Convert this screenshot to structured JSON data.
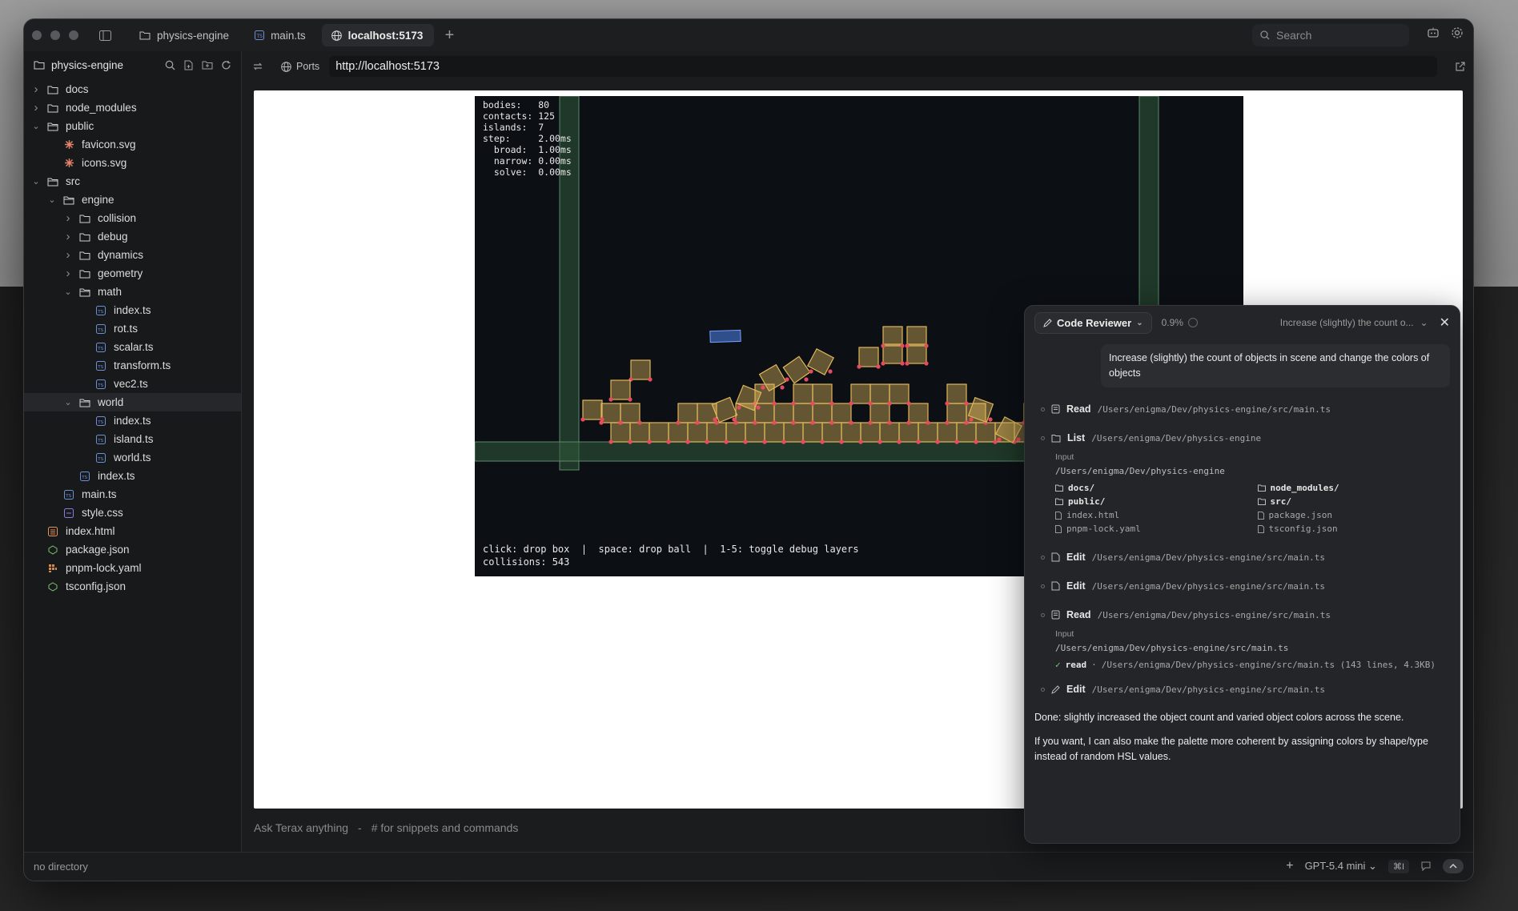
{
  "titlebar": {
    "tabs": [
      {
        "label": "physics-engine",
        "icon": "folder-icon"
      },
      {
        "label": "main.ts",
        "icon": "typescript-file-icon"
      },
      {
        "label": "localhost:5173",
        "icon": "globe-icon"
      }
    ],
    "search_placeholder": "Search"
  },
  "sidebar": {
    "project": "physics-engine",
    "tree": [
      {
        "label": "docs",
        "depth": 0,
        "type": "folder",
        "open": false
      },
      {
        "label": "node_modules",
        "depth": 0,
        "type": "folder",
        "open": false
      },
      {
        "label": "public",
        "depth": 0,
        "type": "folder",
        "open": true
      },
      {
        "label": "favicon.svg",
        "depth": 1,
        "type": "svg"
      },
      {
        "label": "icons.svg",
        "depth": 1,
        "type": "svg"
      },
      {
        "label": "src",
        "depth": 0,
        "type": "folder",
        "open": true
      },
      {
        "label": "engine",
        "depth": 1,
        "type": "folder",
        "open": true
      },
      {
        "label": "collision",
        "depth": 2,
        "type": "folder",
        "open": false
      },
      {
        "label": "debug",
        "depth": 2,
        "type": "folder",
        "open": false
      },
      {
        "label": "dynamics",
        "depth": 2,
        "type": "folder",
        "open": false
      },
      {
        "label": "geometry",
        "depth": 2,
        "type": "folder",
        "open": false
      },
      {
        "label": "math",
        "depth": 2,
        "type": "folder",
        "open": true
      },
      {
        "label": "index.ts",
        "depth": 3,
        "type": "ts"
      },
      {
        "label": "rot.ts",
        "depth": 3,
        "type": "ts"
      },
      {
        "label": "scalar.ts",
        "depth": 3,
        "type": "ts"
      },
      {
        "label": "transform.ts",
        "depth": 3,
        "type": "ts"
      },
      {
        "label": "vec2.ts",
        "depth": 3,
        "type": "ts"
      },
      {
        "label": "world",
        "depth": 2,
        "type": "folder",
        "open": true
      },
      {
        "label": "index.ts",
        "depth": 3,
        "type": "ts"
      },
      {
        "label": "island.ts",
        "depth": 3,
        "type": "ts"
      },
      {
        "label": "world.ts",
        "depth": 3,
        "type": "ts"
      },
      {
        "label": "index.ts",
        "depth": 2,
        "type": "ts"
      },
      {
        "label": "main.ts",
        "depth": 1,
        "type": "ts"
      },
      {
        "label": "style.css",
        "depth": 1,
        "type": "css"
      },
      {
        "label": "index.html",
        "depth": 0,
        "type": "html"
      },
      {
        "label": "package.json",
        "depth": 0,
        "type": "json"
      },
      {
        "label": "pnpm-lock.yaml",
        "depth": 0,
        "type": "yaml"
      },
      {
        "label": "tsconfig.json",
        "depth": 0,
        "type": "json"
      }
    ]
  },
  "browser": {
    "ports_label": "Ports",
    "url": "http://localhost:5173"
  },
  "sim": {
    "hud": "bodies:   80\ncontacts: 125\nislands:  7\nstep:     2.00ms\n  broad:  1.00ms\n  narrow: 0.00ms\n  solve:  0.00ms",
    "footer": "click: drop box  |  space: drop ball  |  1-5: toggle debug layers\ncollisions: 543"
  },
  "ask_bar": {
    "placeholder": "Ask Terax anything",
    "separator": "-",
    "hint": "# for snippets and commands"
  },
  "agent_panel": {
    "agent_name": "Code Reviewer",
    "context_pct": "0.9%",
    "title": "Increase (slightly) the count o...",
    "user_message": "Increase (slightly) the count of objects in scene and change the colors of objects",
    "steps": [
      {
        "action": "Read",
        "path": "/Users/enigma/Dev/physics-engine/src/main.ts"
      },
      {
        "action": "List",
        "path": "/Users/enigma/Dev/physics-engine"
      },
      {
        "action": "Edit",
        "path": "/Users/enigma/Dev/physics-engine/src/main.ts"
      },
      {
        "action": "Edit",
        "path": "/Users/enigma/Dev/physics-engine/src/main.ts"
      },
      {
        "action": "Read",
        "path": "/Users/enigma/Dev/physics-engine/src/main.ts"
      },
      {
        "action": "Edit",
        "path": "/Users/enigma/Dev/physics-engine/src/main.ts"
      }
    ],
    "input_label": "Input",
    "list_input": "/Users/enigma/Dev/physics-engine",
    "list_items": [
      "docs/",
      "node_modules/",
      "public/",
      "src/",
      "index.html",
      "package.json",
      "pnpm-lock.yaml",
      "tsconfig.json"
    ],
    "read_input": "/Users/enigma/Dev/physics-engine/src/main.ts",
    "read_result_label": "read",
    "read_result": "/Users/enigma/Dev/physics-engine/src/main.ts (143 lines, 4.3KB)",
    "done_1": "Done: slightly increased the object count and varied object colors across the scene.",
    "done_2": "If you want, I can also make the palette more coherent by assigning colors by shape/type instead of random HSL values."
  },
  "statusbar": {
    "left": "no directory",
    "model": "GPT-5.4 mini",
    "shortcut": "⌘I"
  },
  "colors": {
    "accent_box": "#e0b85a",
    "contact_point": "#e84a5f",
    "wall": "#2f5a3a",
    "falling_box": "#4a78d8"
  }
}
